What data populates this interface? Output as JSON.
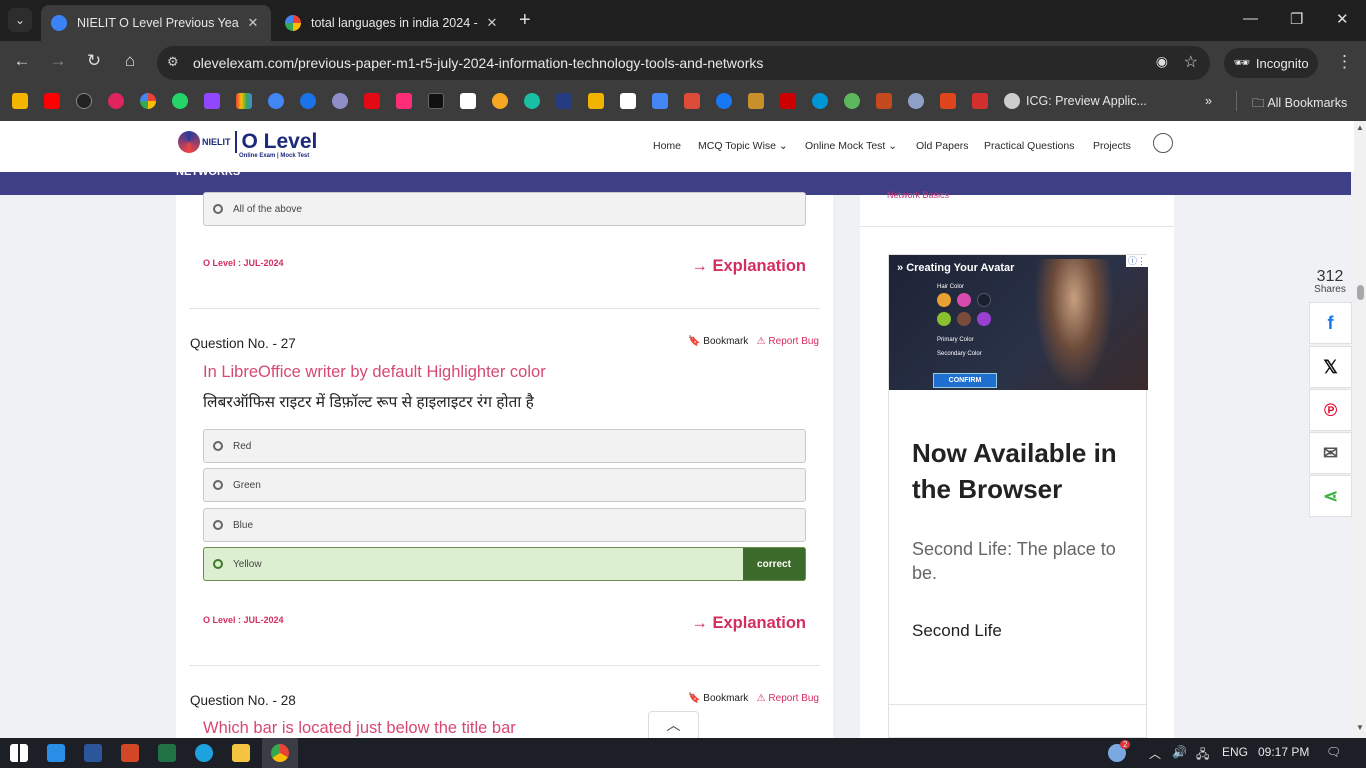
{
  "browser": {
    "tabs": [
      {
        "title": "NIELIT O Level Previous Year So",
        "active": true
      },
      {
        "title": "total languages in india 2024 -",
        "active": false
      }
    ],
    "url": "olevelexam.com/previous-paper-m1-r5-july-2024-information-technology-tools-and-networks",
    "incognito_label": "Incognito",
    "bookmark_text": "ICG: Preview Applic...",
    "all_bookmarks": "All Bookmarks"
  },
  "site": {
    "logo_small": "NIELIT",
    "logo_big": "O Level",
    "logo_tag": "Online Exam | Mock Test",
    "nav": [
      "Home",
      "MCQ Topic Wise",
      "Online Mock Test",
      "Old Papers",
      "Practical Questions",
      "Projects"
    ],
    "banner_text": "NETWORKS"
  },
  "content": {
    "prev_option": "All of the above",
    "prev_tag": "O Level : JUL-2024",
    "explanation": "→ Explanation",
    "bookmark": "Bookmark",
    "report_bug": "Report Bug",
    "q27": {
      "number": "Question No. - 27",
      "en": "In LibreOffice writer by default Highlighter color",
      "hi": "लिबरऑफिस राइटर में डिफ़ॉल्ट रूप से हाइलाइटर रंग होता है",
      "options": [
        "Red",
        "Green",
        "Blue",
        "Yellow"
      ],
      "correct_label": "correct",
      "tag": "O Level : JUL-2024"
    },
    "q28": {
      "number": "Question No. - 28",
      "en": "Which bar is located just below the title bar"
    }
  },
  "sidebar": {
    "link": "Network Basics",
    "ad": {
      "image_title": "Creating Your Avatar",
      "hair_color": "Hair Color",
      "primary_color": "Primary Color",
      "secondary_color": "Secondary Color",
      "confirm": "CONFIRM",
      "heading": "Now Available in the Browser",
      "body": "Second Life: The place to be.",
      "brand": "Second Life"
    }
  },
  "share": {
    "count": "312",
    "label": "Shares",
    "buttons": [
      "facebook",
      "x",
      "pinterest",
      "email",
      "share"
    ]
  },
  "taskbar": {
    "lang": "ENG",
    "time": "09:17 PM",
    "weather_badge": "2"
  },
  "colors": {
    "accent": "#d42e5e",
    "banner": "#3e3f85",
    "correct": "#3c6b2b"
  }
}
